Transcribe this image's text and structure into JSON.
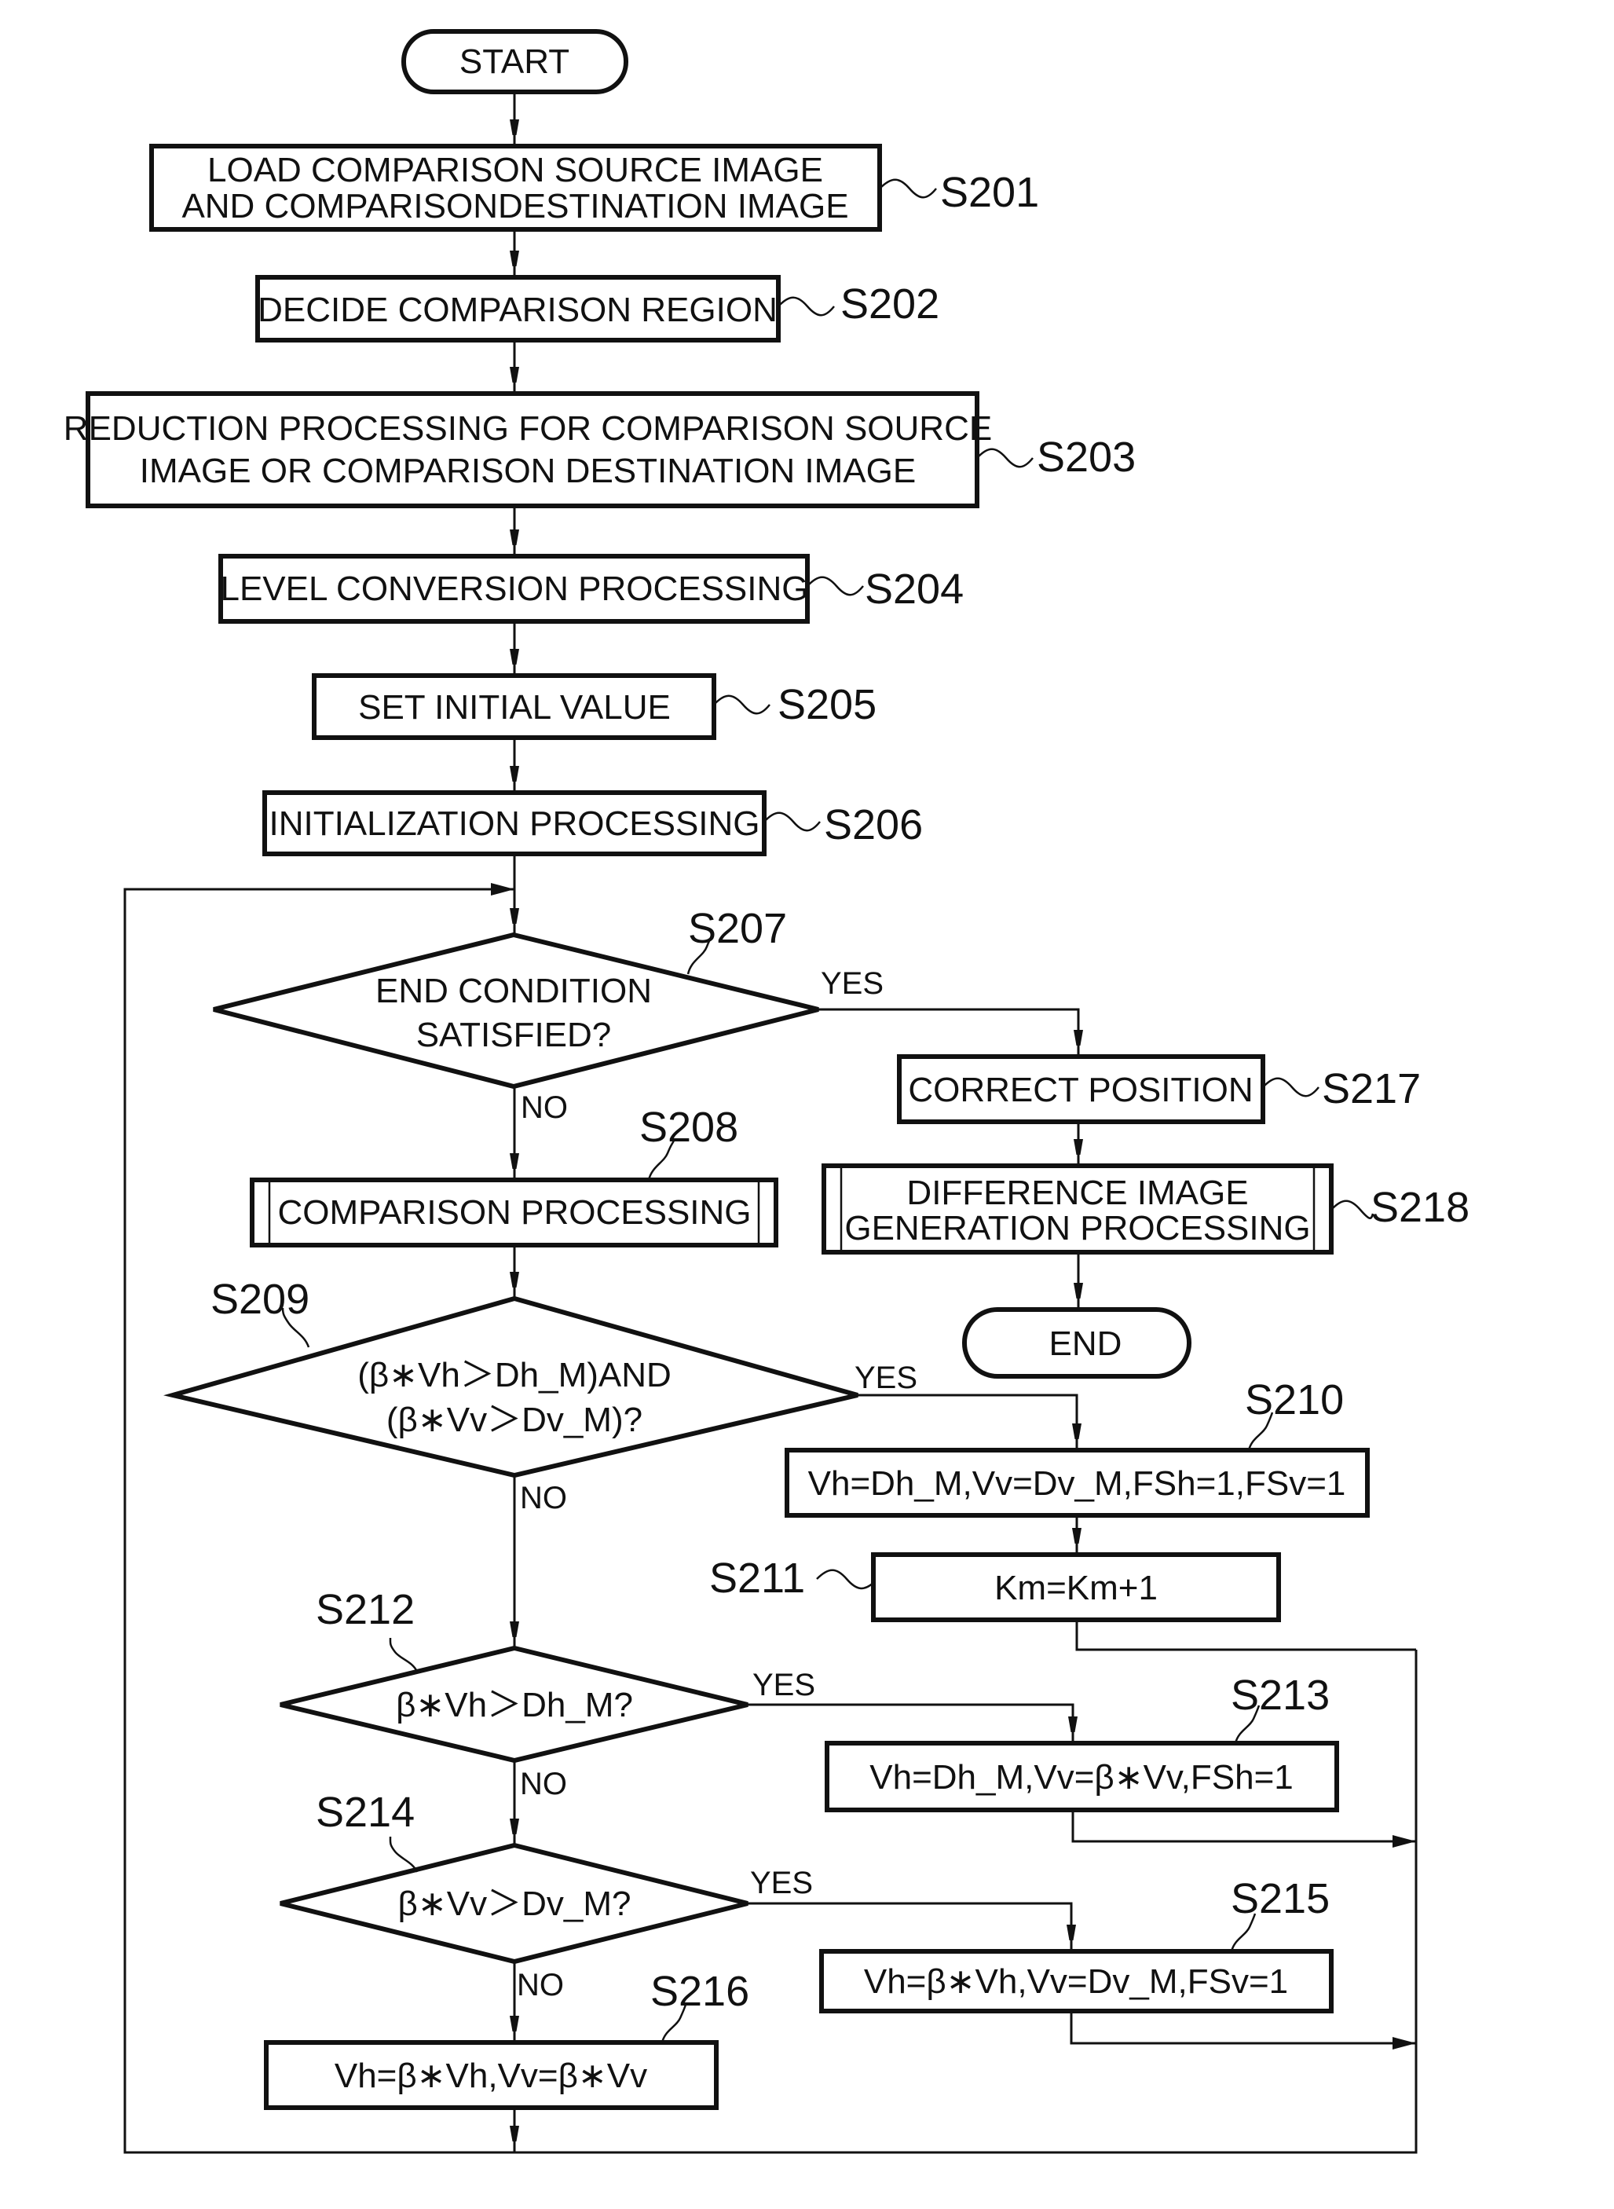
{
  "figure": {
    "start_label": "START",
    "end_label": "END",
    "yes_label": "YES",
    "no_label": "NO"
  },
  "steps": {
    "s201": {
      "id": "S201",
      "lines": [
        "LOAD COMPARISON SOURCE IMAGE",
        "AND COMPARISONDESTINATION IMAGE"
      ]
    },
    "s202": {
      "id": "S202",
      "lines": [
        "DECIDE COMPARISON REGION"
      ]
    },
    "s203": {
      "id": "S203",
      "lines": [
        "REDUCTION PROCESSING FOR COMPARISON SOURCE",
        "IMAGE OR COMPARISON DESTINATION IMAGE"
      ]
    },
    "s204": {
      "id": "S204",
      "lines": [
        "LEVEL CONVERSION PROCESSING"
      ]
    },
    "s205": {
      "id": "S205",
      "lines": [
        "SET INITIAL VALUE"
      ]
    },
    "s206": {
      "id": "S206",
      "lines": [
        "INITIALIZATION PROCESSING"
      ]
    },
    "s207": {
      "id": "S207",
      "lines": [
        "END CONDITION",
        "SATISFIED?"
      ]
    },
    "s208": {
      "id": "S208",
      "lines": [
        "COMPARISON PROCESSING"
      ]
    },
    "s209": {
      "id": "S209",
      "lines": [
        "(β∗Vh＞Dh_M)AND",
        "(β∗Vv＞Dv_M)?"
      ]
    },
    "s210": {
      "id": "S210",
      "lines": [
        "Vh=Dh_M,Vv=Dv_M,FSh=1,FSv=1"
      ]
    },
    "s211": {
      "id": "S211",
      "lines": [
        "Km=Km+1"
      ]
    },
    "s212": {
      "id": "S212",
      "lines": [
        "β∗Vh＞Dh_M?"
      ]
    },
    "s213": {
      "id": "S213",
      "lines": [
        "Vh=Dh_M,Vv=β∗Vv,FSh=1"
      ]
    },
    "s214": {
      "id": "S214",
      "lines": [
        "β∗Vv＞Dv_M?"
      ]
    },
    "s215": {
      "id": "S215",
      "lines": [
        "Vh=β∗Vh,Vv=Dv_M,FSv=1"
      ]
    },
    "s216": {
      "id": "S216",
      "lines": [
        "Vh=β∗Vh,Vv=β∗Vv"
      ]
    },
    "s217": {
      "id": "S217",
      "lines": [
        "CORRECT POSITION"
      ]
    },
    "s218": {
      "id": "S218",
      "lines": [
        "DIFFERENCE IMAGE",
        "GENERATION PROCESSING"
      ]
    }
  }
}
